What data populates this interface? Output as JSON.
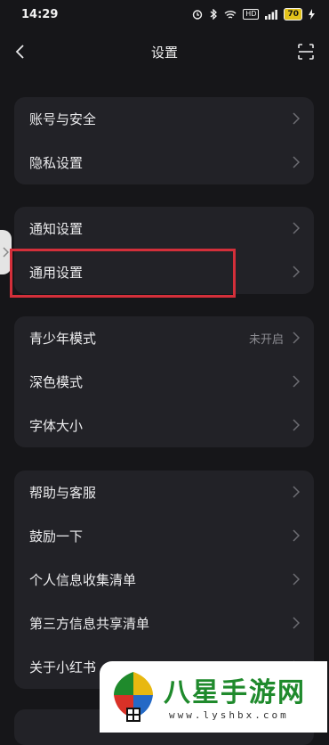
{
  "status": {
    "time": "14:29",
    "battery": "70",
    "hd": "HD"
  },
  "header": {
    "title": "设置",
    "back_icon": "chevron-left-icon",
    "scan_icon": "scan-icon"
  },
  "groups": [
    {
      "items": [
        {
          "label": "账号与安全"
        },
        {
          "label": "隐私设置"
        }
      ]
    },
    {
      "items": [
        {
          "label": "通知设置"
        },
        {
          "label": "通用设置"
        }
      ]
    },
    {
      "items": [
        {
          "label": "青少年模式",
          "value": "未开启"
        },
        {
          "label": "深色模式"
        },
        {
          "label": "字体大小"
        }
      ]
    },
    {
      "items": [
        {
          "label": "帮助与客服"
        },
        {
          "label": "鼓励一下"
        },
        {
          "label": "个人信息收集清单"
        },
        {
          "label": "第三方信息共享清单"
        },
        {
          "label": "关于小红书"
        }
      ]
    }
  ],
  "watermark": {
    "title": "八星手游网",
    "url": "www.lyshbx.com"
  },
  "colors": {
    "background": "#161619",
    "card": "#222227",
    "highlight": "#d32f3a"
  }
}
